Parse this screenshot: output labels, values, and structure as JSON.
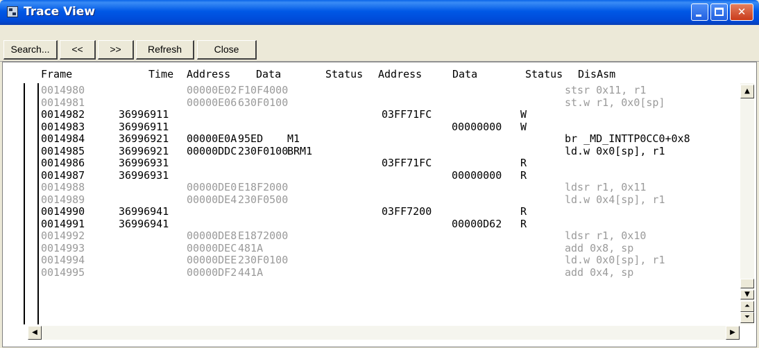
{
  "window": {
    "title": "Trace View"
  },
  "toolbar": {
    "search_label": "Search...",
    "back_label": "<<",
    "forward_label": ">>",
    "refresh_label": "Refresh",
    "close_label": "Close"
  },
  "table": {
    "headers": [
      "Frame",
      "Time",
      "Address",
      "Data",
      "Status",
      "Address",
      "Data",
      "Status",
      "DisAsm"
    ],
    "rows": [
      {
        "style": "dim",
        "frame": "0014980",
        "time": "",
        "addr1": "00000E02",
        "data1": "F10F4000",
        "status1": "",
        "addr2": "",
        "data2": "",
        "status2": "",
        "disasm": "stsr 0x11, r1"
      },
      {
        "style": "dim",
        "frame": "0014981",
        "time": "",
        "addr1": "00000E06",
        "data1": "630F0100",
        "status1": "",
        "addr2": "",
        "data2": "",
        "status2": "",
        "disasm": "st.w r1, 0x0[sp]"
      },
      {
        "style": "bright",
        "frame": "0014982",
        "time": "36996911",
        "addr1": "",
        "data1": "",
        "status1": "",
        "addr2": "03FF71FC",
        "data2": "",
        "status2": "W",
        "disasm": ""
      },
      {
        "style": "bright",
        "frame": "0014983",
        "time": "36996911",
        "addr1": "",
        "data1": "",
        "status1": "",
        "addr2": "",
        "data2": "00000000",
        "status2": "W",
        "disasm": ""
      },
      {
        "style": "bright",
        "frame": "0014984",
        "time": "36996921",
        "addr1": "00000E0A",
        "data1": "95ED",
        "status1": "M1",
        "addr2": "",
        "data2": "",
        "status2": "",
        "disasm": "br _MD_INTTP0CC0+0x8"
      },
      {
        "style": "bright",
        "frame": "0014985",
        "time": "36996921",
        "addr1": "00000DDC",
        "data1": "230F0100",
        "status1": "BRM1",
        "addr2": "",
        "data2": "",
        "status2": "",
        "disasm": "ld.w 0x0[sp], r1"
      },
      {
        "style": "bright",
        "frame": "0014986",
        "time": "36996931",
        "addr1": "",
        "data1": "",
        "status1": "",
        "addr2": "03FF71FC",
        "data2": "",
        "status2": "R",
        "disasm": ""
      },
      {
        "style": "bright",
        "frame": "0014987",
        "time": "36996931",
        "addr1": "",
        "data1": "",
        "status1": "",
        "addr2": "",
        "data2": "00000000",
        "status2": "R",
        "disasm": ""
      },
      {
        "style": "dim",
        "frame": "0014988",
        "time": "",
        "addr1": "00000DE0",
        "data1": "E18F2000",
        "status1": "",
        "addr2": "",
        "data2": "",
        "status2": "",
        "disasm": "ldsr r1, 0x11"
      },
      {
        "style": "dim",
        "frame": "0014989",
        "time": "",
        "addr1": "00000DE4",
        "data1": "230F0500",
        "status1": "",
        "addr2": "",
        "data2": "",
        "status2": "",
        "disasm": "ld.w 0x4[sp], r1"
      },
      {
        "style": "bright",
        "frame": "0014990",
        "time": "36996941",
        "addr1": "",
        "data1": "",
        "status1": "",
        "addr2": "03FF7200",
        "data2": "",
        "status2": "R",
        "disasm": ""
      },
      {
        "style": "bright",
        "frame": "0014991",
        "time": "36996941",
        "addr1": "",
        "data1": "",
        "status1": "",
        "addr2": "",
        "data2": "00000D62",
        "status2": "R",
        "disasm": ""
      },
      {
        "style": "dim",
        "frame": "0014992",
        "time": "",
        "addr1": "00000DE8",
        "data1": "E1872000",
        "status1": "",
        "addr2": "",
        "data2": "",
        "status2": "",
        "disasm": "ldsr r1, 0x10"
      },
      {
        "style": "dim",
        "frame": "0014993",
        "time": "",
        "addr1": "00000DEC",
        "data1": "481A",
        "status1": "",
        "addr2": "",
        "data2": "",
        "status2": "",
        "disasm": "add 0x8, sp"
      },
      {
        "style": "dim",
        "frame": "0014994",
        "time": "",
        "addr1": "00000DEE",
        "data1": "230F0100",
        "status1": "",
        "addr2": "",
        "data2": "",
        "status2": "",
        "disasm": "ld.w 0x0[sp], r1"
      },
      {
        "style": "dim",
        "frame": "0014995",
        "time": "",
        "addr1": "00000DF2",
        "data1": "441A",
        "status1": "",
        "addr2": "",
        "data2": "",
        "status2": "",
        "disasm": "add 0x4, sp"
      }
    ]
  },
  "icons": {
    "app": "trace-view-icon",
    "scroll_up": "arrow-up-icon",
    "scroll_down": "arrow-down-icon",
    "scroll_left": "arrow-left-icon",
    "scroll_right": "arrow-right-icon"
  },
  "colors": {
    "titlebar": "#0058e6",
    "dim_row_text": "#9a9a9a",
    "bright_row_text": "#000000"
  }
}
